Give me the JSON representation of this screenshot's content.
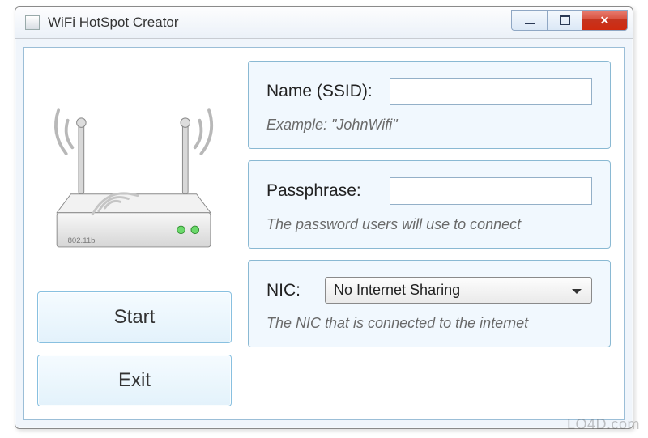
{
  "window": {
    "title": "WiFi HotSpot Creator"
  },
  "buttons": {
    "start": "Start",
    "exit": "Exit"
  },
  "ssid": {
    "label": "Name (SSID):",
    "value": "",
    "hint": "Example: \"JohnWifi\""
  },
  "pass": {
    "label": "Passphrase:",
    "value": "",
    "hint": "The password users will use to connect"
  },
  "nic": {
    "label": "NIC:",
    "selected": "No Internet Sharing",
    "hint": "The NIC that is connected to the internet"
  },
  "router_label": "802.11b",
  "watermark": "LO4D.com"
}
